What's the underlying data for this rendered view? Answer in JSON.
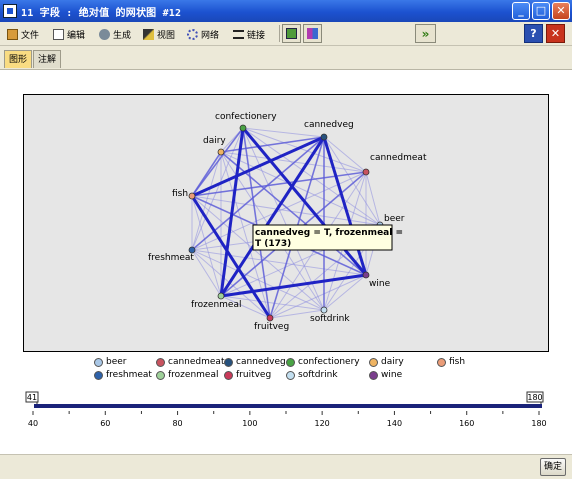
{
  "window": {
    "title": "11 字段 : 绝对值 的网状图 #12",
    "controls": [
      "_",
      "□",
      "✕"
    ]
  },
  "toolbar": {
    "menus": [
      {
        "label": "文件",
        "icon": "file-icon"
      },
      {
        "label": "编辑",
        "icon": "edit-icon"
      },
      {
        "label": "生成",
        "icon": "generate-icon"
      },
      {
        "label": "视图",
        "icon": "view-icon"
      },
      {
        "label": "网络",
        "icon": "network-icon"
      },
      {
        "label": "链接",
        "icon": "links-icon"
      }
    ],
    "forward_icon": "»",
    "help_icon": "?",
    "close_icon": "✕"
  },
  "tabs": [
    {
      "label": "图形",
      "active": true
    },
    {
      "label": "注解",
      "active": false
    }
  ],
  "graph": {
    "nodes": [
      {
        "name": "beer",
        "color": "#a9c7e6"
      },
      {
        "name": "cannedmeat",
        "color": "#c8535f"
      },
      {
        "name": "cannedveg",
        "color": "#27517d"
      },
      {
        "name": "confectionery",
        "color": "#4aa345"
      },
      {
        "name": "dairy",
        "color": "#efb463"
      },
      {
        "name": "fish",
        "color": "#ea9c78"
      },
      {
        "name": "freshmeat",
        "color": "#2e62aa"
      },
      {
        "name": "frozenmeal",
        "color": "#9fd19a"
      },
      {
        "name": "fruitveg",
        "color": "#c93a5a"
      },
      {
        "name": "softdrink",
        "color": "#c3dff0"
      },
      {
        "name": "wine",
        "color": "#7a3e8c"
      }
    ],
    "tooltip": {
      "line1": "cannedveg = T, frozenmeal =",
      "line2": "T (173)"
    }
  },
  "slider": {
    "min_label": "41",
    "max_label": "180",
    "ticks": [
      "40",
      "60",
      "80",
      "100",
      "120",
      "140",
      "160",
      "180"
    ]
  },
  "footer": {
    "ok_label": "确定"
  }
}
